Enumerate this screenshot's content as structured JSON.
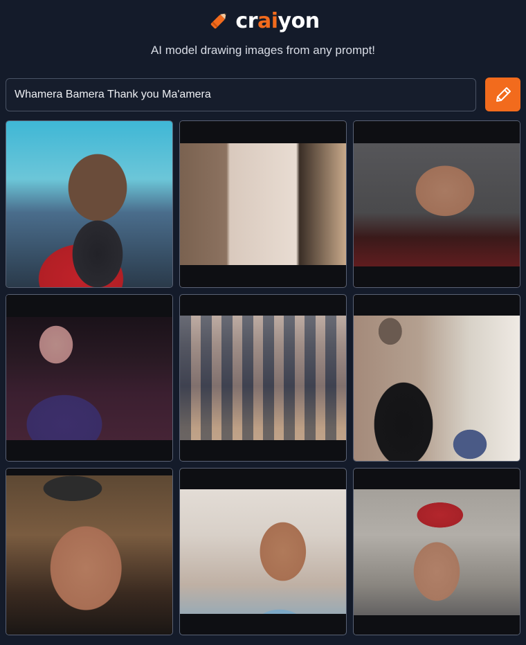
{
  "app": {
    "logo_prefix": "cr",
    "logo_accent": "ai",
    "logo_suffix": "yon",
    "tagline": "AI model drawing images from any prompt!",
    "accent_color": "#f26b1d",
    "background_color": "#141b2a"
  },
  "prompt": {
    "value": "Whamera Bamera Thank you Ma'amera",
    "placeholder": ""
  },
  "draw_button": {
    "icon": "pencil-icon",
    "title": "Draw"
  },
  "images": [
    {
      "alt": "Generated image 1"
    },
    {
      "alt": "Generated image 2"
    },
    {
      "alt": "Generated image 3"
    },
    {
      "alt": "Generated image 4"
    },
    {
      "alt": "Generated image 5"
    },
    {
      "alt": "Generated image 6"
    },
    {
      "alt": "Generated image 7"
    },
    {
      "alt": "Generated image 8"
    },
    {
      "alt": "Generated image 9"
    }
  ]
}
